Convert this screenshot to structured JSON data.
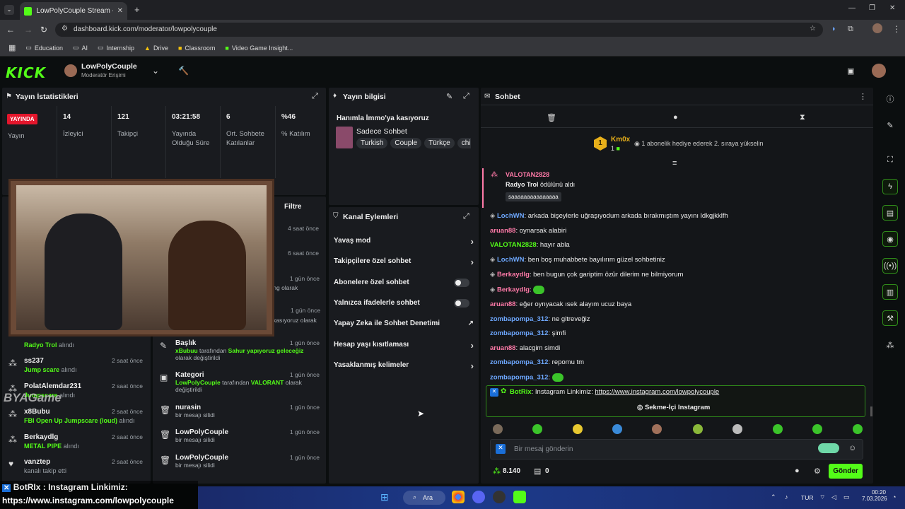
{
  "browser": {
    "tab_title": "LowPolyCouple Stream - Kick D",
    "url": "dashboard.kick.com/moderator/lowpolycouple",
    "bookmarks": [
      "Education",
      "AI",
      "Internship",
      "Drive",
      "Classroom",
      "Video Game Insight..."
    ]
  },
  "header": {
    "logo": "KICK",
    "channel_name": "LowPolyCouple",
    "role": "Moderatör Erişimi"
  },
  "stats": {
    "title": "Yayın İstatistikleri",
    "live_badge": "YAYINDA",
    "live_label": "Yayın",
    "items": [
      {
        "value": "14",
        "label": "İzleyici"
      },
      {
        "value": "121",
        "label": "Takipçi"
      },
      {
        "value": "03:21:58",
        "label": "Yayında Olduğu Süre"
      },
      {
        "value": "6",
        "label": "Ort. Sohbete Katılanlar"
      },
      {
        "value": "%46",
        "label": "% Katılım"
      }
    ]
  },
  "activity": {
    "filter_label": "Filtre",
    "times_top": [
      "4 saat önce",
      "6 saat önce"
    ],
    "rows": [
      {
        "name": "",
        "detail": "Radyo Trol",
        "detail_suffix": "alındı",
        "time": ""
      },
      {
        "name": "ss237",
        "detail": "Jump scare",
        "detail_suffix": "alındı",
        "time": "2 saat önce"
      },
      {
        "name": "PolatAlemdar231",
        "detail": "Jumpscare",
        "detail_suffix": "alındı",
        "time": "2 saat önce"
      },
      {
        "name": "x8Bubu",
        "detail": "FBI Open Up Jumpscare (loud)",
        "detail_suffix": "alındı",
        "time": "2 saat önce"
      },
      {
        "name": "Berkaydlg",
        "detail": "METAL PIPE",
        "detail_suffix": "alındı",
        "time": "2 saat önce"
      },
      {
        "name": "vanztep",
        "detail": "kanalı takip etti",
        "detail_suffix": "",
        "time": "2 saat önce"
      }
    ]
  },
  "events": {
    "partial": [
      {
        "text": "ting olarak",
        "time": "1 gün önce"
      },
      {
        "text": "kasıyoruz olarak",
        "time": "1 gün önce"
      }
    ],
    "rows": [
      {
        "name": "Başlık",
        "user": "xBubuu",
        "mid": "tarafından",
        "value": "Sahur yapıyoruz geleceğiz",
        "end": "olarak değiştirildi",
        "time": "1 gün önce"
      },
      {
        "name": "Kategori",
        "user": "LowPolyCouple",
        "mid": "tarafından",
        "value": "VALORANT",
        "end": "olarak değiştirildi",
        "time": "1 gün önce"
      },
      {
        "name": "nurasin",
        "user": "",
        "mid": "bir mesajı silidi",
        "value": "",
        "end": "",
        "time": "1 gün önce"
      },
      {
        "name": "LowPolyCouple",
        "user": "",
        "mid": "bir mesajı silidi",
        "value": "",
        "end": "",
        "time": "1 gün önce"
      },
      {
        "name": "LowPolyCouple",
        "user": "",
        "mid": "bir mesajı silidi",
        "value": "",
        "end": "",
        "time": "1 gün önce"
      }
    ]
  },
  "stream_info": {
    "title": "Yayın bilgisi",
    "stream_title": "Hanımla İmmo'ya kasıyoruz",
    "category": "Sadece Sohbet",
    "tags": [
      "Turkish",
      "Couple",
      "Türkçe",
      "chil"
    ]
  },
  "channel_actions": {
    "title": "Kanal Eylemleri",
    "items": [
      {
        "label": "Yavaş mod",
        "control": "arrow"
      },
      {
        "label": "Takipçilere özel sohbet",
        "control": "arrow"
      },
      {
        "label": "Abonelere özel sohbet",
        "control": "toggle"
      },
      {
        "label": "Yalnızca ifadelerle sohbet",
        "control": "toggle"
      },
      {
        "label": "Yapay Zeka ile Sohbet Denetimi",
        "control": "external"
      },
      {
        "label": "Hesap yaşı kısıtlaması",
        "control": "arrow"
      },
      {
        "label": "Yasaklanmış kelimeler",
        "control": "arrow"
      }
    ]
  },
  "chat": {
    "title": "Sohbet",
    "gifter_name": "Km0x",
    "gifter_count": "1",
    "gifter_rank": "1",
    "gift_cta": "1 abonelik hediye ederek 2. sıraya yükselin",
    "pinned": {
      "user": "VALOTAN2828",
      "action": "Radyo Trol",
      "action_suffix": "ödülünü aldı",
      "message": "saaaaaaaaaaaaaaa"
    },
    "messages": [
      {
        "user": "LochWN",
        "text": "arkada bişeylerle uğraşıyodum arkada bırakmıştım yayını ldkgjkklfh",
        "color": "#6ea8ff"
      },
      {
        "user": "aruan88",
        "text": "oynarsak alabiri",
        "color": "#ff7aa8"
      },
      {
        "user": "VALOTAN2828",
        "text": "hayır abla",
        "color": "#53fc18"
      },
      {
        "user": "LochWN",
        "text": "ben boş muhabbete bayılırım güzel sohbetiniz",
        "color": "#6ea8ff"
      },
      {
        "user": "Berkaydlg",
        "text": "ben bugun çok gariptim özür dilerim ne bilmiyorum",
        "color": "#ff7aa8"
      },
      {
        "user": "Berkaydlg",
        "text": "",
        "color": "#ff7aa8"
      },
      {
        "user": "aruan88",
        "text": "eğer oynyacak ısek alayım ucuz baya",
        "color": "#ff7aa8"
      },
      {
        "user": "zombapompa_312",
        "text": "ne gitreveğiz",
        "color": "#6ea8ff"
      },
      {
        "user": "zombapompa_312",
        "text": "şimfi",
        "color": "#6ea8ff"
      },
      {
        "user": "aruan88",
        "text": "alacgim simdi",
        "color": "#ff7aa8"
      },
      {
        "user": "zombapompa_312",
        "text": "repomu tm",
        "color": "#6ea8ff"
      },
      {
        "user": "zombapompa_312",
        "text": "",
        "color": "#6ea8ff"
      }
    ],
    "bot": {
      "user": "BotRix",
      "text": "Instagram Linkimiz:",
      "link": "https://www.instagram.com/lowpolycouple",
      "button": "Sekme-İçi Instagram"
    },
    "input_placeholder": "Bir mesaj gönderin",
    "points": "8.140",
    "redemptions": "0",
    "send_label": "Gönder"
  },
  "overlay": {
    "line1": "BotRIx : Instagram Linkimiz:",
    "line2": "https://www.instagram.com/lowpolycouple",
    "watermark": "BYAGame"
  },
  "taskbar": {
    "search": "Ara",
    "lang": "TUR",
    "time": "00:20",
    "date": "7.03.2026"
  }
}
